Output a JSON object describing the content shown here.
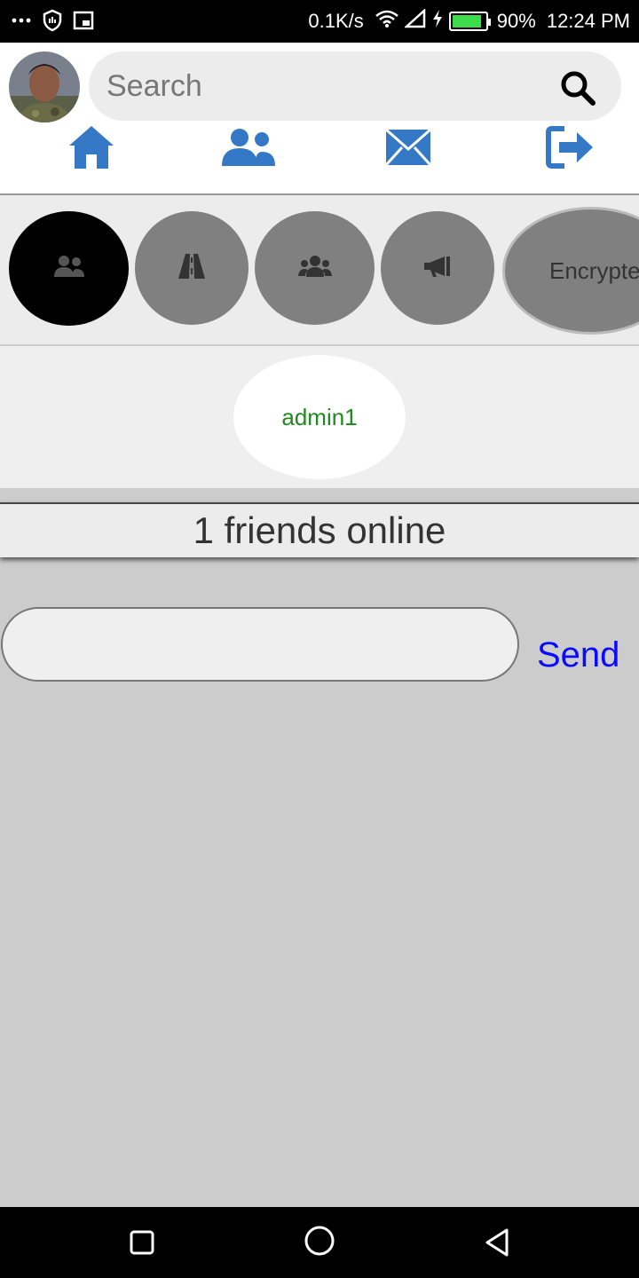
{
  "status_bar": {
    "left_icons": [
      "more-icon",
      "shield-icon",
      "cast-icon"
    ],
    "net_speed": "0.1K/s",
    "battery_percent": "90%",
    "battery_level": 0.9,
    "time": "12:24 PM",
    "right_icons": [
      "wifi-icon",
      "signal-icon",
      "charging-icon",
      "battery-icon"
    ]
  },
  "header": {
    "search_placeholder": "Search",
    "nav_icons": [
      "home-icon",
      "friends-icon",
      "mail-icon",
      "logout-icon"
    ],
    "accent_color": "#3478c6"
  },
  "groups": {
    "items": [
      {
        "icon": "users-icon",
        "selected": true
      },
      {
        "icon": "road-icon",
        "selected": false
      },
      {
        "icon": "group-icon",
        "selected": false
      },
      {
        "icon": "megaphone-icon",
        "selected": false
      },
      {
        "label": "Encrypte",
        "selected": false
      }
    ]
  },
  "members": {
    "online_user": "admin1"
  },
  "online_status": "1 friends online",
  "composer": {
    "send_label": "Send"
  },
  "nav_bar": {
    "buttons": [
      "recents-icon",
      "home-circle-icon",
      "back-icon"
    ]
  }
}
